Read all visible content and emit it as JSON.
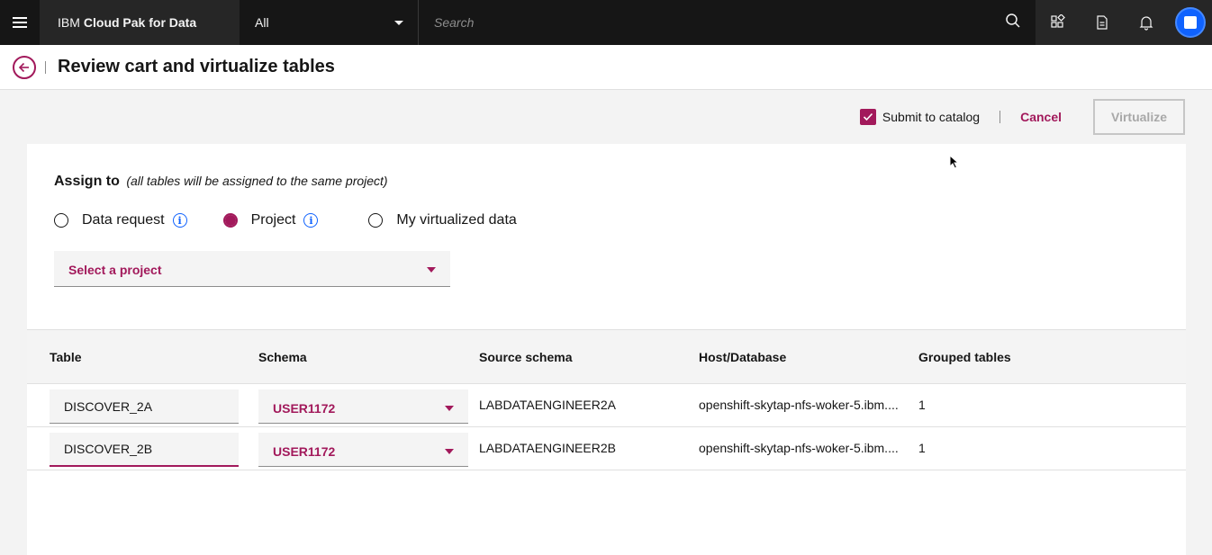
{
  "header": {
    "brand_prefix": "IBM",
    "brand_name": "Cloud Pak for Data",
    "scope_value": "All",
    "search_placeholder": "Search"
  },
  "page": {
    "title": "Review cart and virtualize tables"
  },
  "actions": {
    "submit_to_catalog_label": "Submit to catalog",
    "submit_to_catalog_checked": true,
    "cancel_label": "Cancel",
    "virtualize_label": "Virtualize"
  },
  "assign": {
    "label": "Assign to",
    "hint": "(all tables will be assigned to the same project)",
    "options": [
      {
        "label": "Data request",
        "selected": false
      },
      {
        "label": "Project",
        "selected": true
      },
      {
        "label": "My virtualized data",
        "selected": false
      }
    ],
    "project_placeholder": "Select a project"
  },
  "table": {
    "columns": [
      "Table",
      "Schema",
      "Source schema",
      "Host/Database",
      "Grouped tables"
    ],
    "rows": [
      {
        "table": "DISCOVER_2A",
        "schema": "USER1172",
        "source_schema": "LABDATAENGINEER2A",
        "host": "openshift-skytap-nfs-woker-5.ibm....",
        "grouped": "1"
      },
      {
        "table": "DISCOVER_2B",
        "schema": "USER1172",
        "source_schema": "LABDATAENGINEER2B",
        "host": "openshift-skytap-nfs-woker-5.ibm....",
        "grouped": "1"
      }
    ]
  },
  "colors": {
    "accent": "#a2195b",
    "topbar": "#161616",
    "info": "#0f62fe"
  }
}
